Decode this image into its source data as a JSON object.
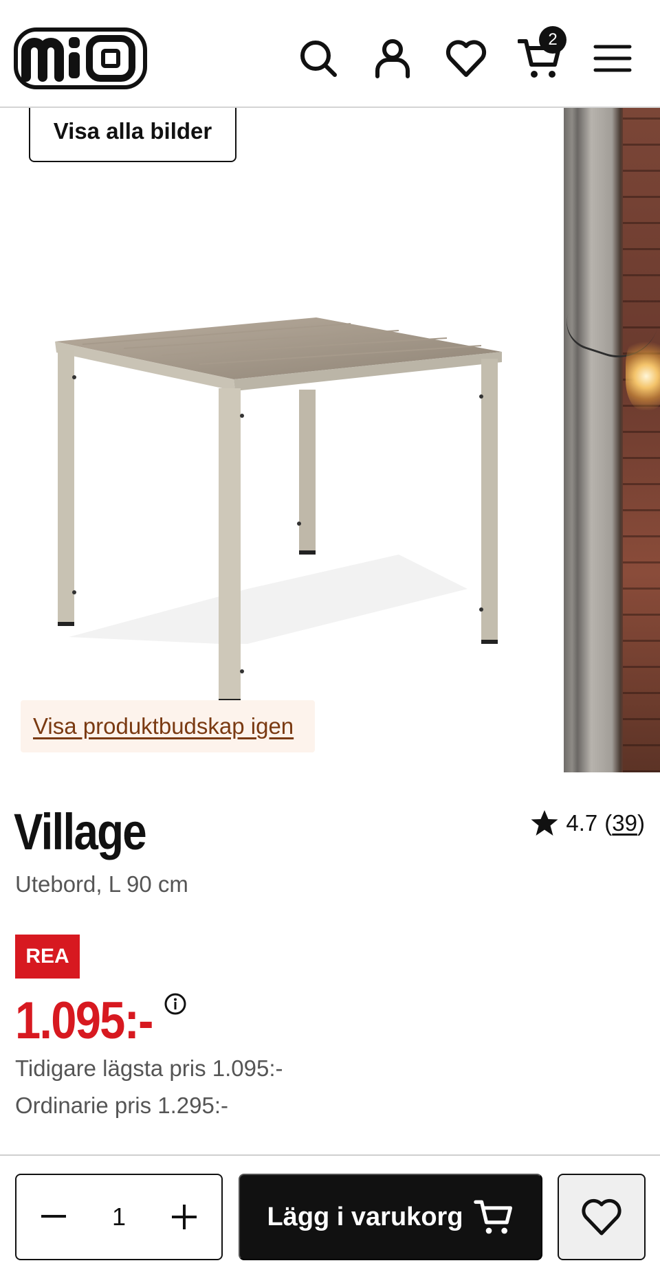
{
  "header": {
    "logo_text": "mio",
    "cart_count": "2",
    "icons": [
      "search-icon",
      "user-icon",
      "heart-icon",
      "cart-icon",
      "menu-icon"
    ]
  },
  "gallery": {
    "show_all_images_label": "Visa alla bilder",
    "show_message_again_label": "Visa produktbudskap igen"
  },
  "product": {
    "name": "Village",
    "description": "Utebord, L 90 cm",
    "rating": "4.7",
    "review_count": "39",
    "sale_badge": "REA",
    "price": "1.095:-",
    "previous_lowest_price": "Tidigare lägsta pris 1.095:-",
    "regular_price": "Ordinarie pris 1.295:-"
  },
  "purchase": {
    "quantity": "1",
    "add_to_cart_label": "Lägg i varukorg"
  },
  "colors": {
    "sale_red": "#d71920",
    "primary": "#111111",
    "link_brown": "#7a3a12",
    "link_bg": "#fdf3ec"
  }
}
